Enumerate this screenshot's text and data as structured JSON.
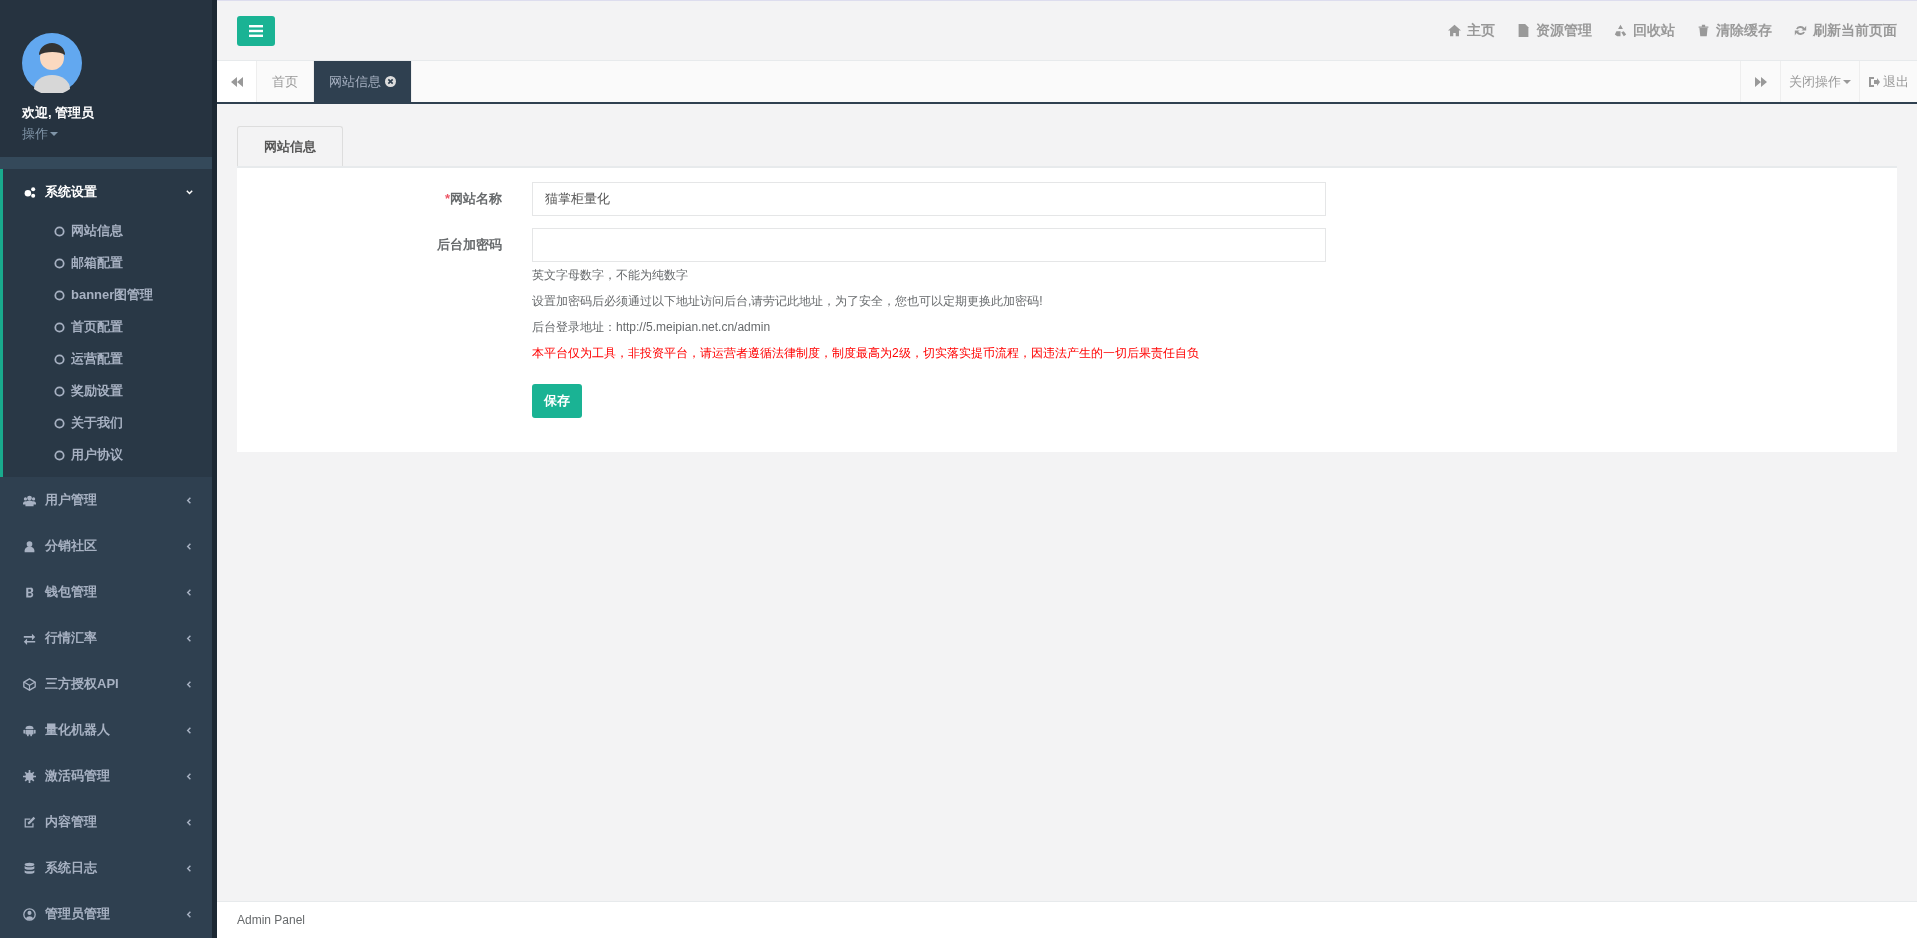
{
  "sidebar": {
    "user": {
      "name": "欢迎, 管理员",
      "menu_label": "操作"
    },
    "menu": [
      {
        "label": "系统设置",
        "expanded": true,
        "children": [
          {
            "label": "网站信息"
          },
          {
            "label": "邮箱配置"
          },
          {
            "label": "banner图管理"
          },
          {
            "label": "首页配置"
          },
          {
            "label": "运营配置"
          },
          {
            "label": "奖励设置"
          },
          {
            "label": "关于我们"
          },
          {
            "label": "用户协议"
          }
        ]
      },
      {
        "label": "用户管理",
        "expanded": false
      },
      {
        "label": "分销社区",
        "expanded": false
      },
      {
        "label": "钱包管理",
        "expanded": false
      },
      {
        "label": "行情汇率",
        "expanded": false
      },
      {
        "label": "三方授权API",
        "expanded": false
      },
      {
        "label": "量化机器人",
        "expanded": false
      },
      {
        "label": "激活码管理",
        "expanded": false
      },
      {
        "label": "内容管理",
        "expanded": false
      },
      {
        "label": "系统日志",
        "expanded": false
      },
      {
        "label": "管理员管理",
        "expanded": false
      }
    ]
  },
  "top_nav": [
    "主页",
    "资源管理",
    "回收站",
    "清除缓存",
    "刷新当前页面"
  ],
  "tabs": [
    {
      "label": "首页",
      "selected": false
    },
    {
      "label": "网站信息",
      "selected": true
    }
  ],
  "tab_actions": {
    "close_menu": "关闭操作",
    "logout": "退出"
  },
  "card": {
    "tab": "网站信息",
    "fields": [
      {
        "label": "网站名称",
        "required_mark": "*",
        "value": "猫掌柜量化"
      },
      {
        "label": "后台加密码"
      }
    ],
    "hints": [
      {
        "kind": "note",
        "text": "英文字母数字，不能为纯数字"
      },
      {
        "kind": "note",
        "text": "设置加密码后必须通过以下地址访问后台,请劳记此地址，为了安全，您也可以定期更换此加密码!"
      },
      {
        "kind": "note",
        "text": "后台登录地址：http://5.meipian.net.cn/admin"
      },
      {
        "kind": "warning",
        "text": "本平台仅为工具，非投资平台，请运营者遵循法律制度，制度最高为2级，切实落实提币流程，因违法产生的一切后果责任自负"
      }
    ],
    "save": "保存"
  },
  "footer": "Admin Panel"
}
